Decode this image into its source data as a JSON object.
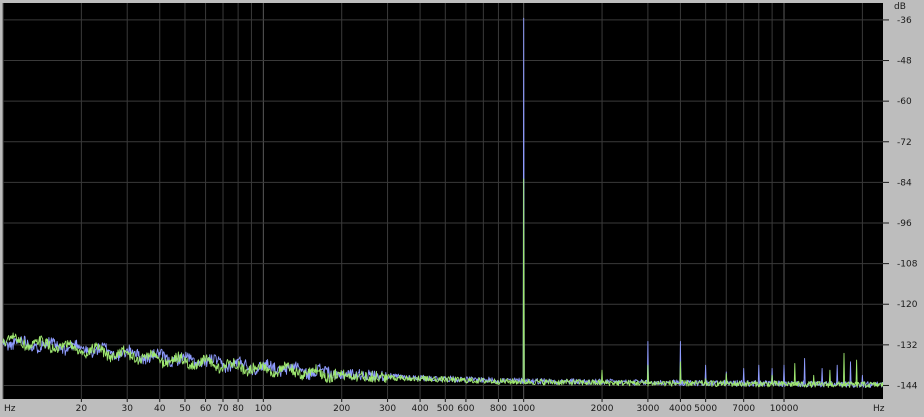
{
  "chart_data": {
    "type": "line",
    "title": "",
    "xlabel": "Hz",
    "ylabel": "dB",
    "x_scale": "log",
    "xlim": [
      10,
      24000
    ],
    "ylim": [
      -148,
      -31
    ],
    "grid": true,
    "x_tick_labels": [
      "20",
      "30",
      "40",
      "50",
      "60",
      "70",
      "80",
      "100",
      "200",
      "300",
      "400",
      "500",
      "600",
      "800",
      "1000",
      "2000",
      "3000",
      "4000",
      "5000",
      "7000",
      "10000"
    ],
    "x_tick_values": [
      20,
      30,
      40,
      50,
      60,
      70,
      80,
      100,
      200,
      300,
      400,
      500,
      600,
      800,
      1000,
      2000,
      3000,
      4000,
      5000,
      7000,
      10000
    ],
    "y_ticks": [
      -36,
      -48,
      -60,
      -72,
      -84,
      -96,
      -108,
      -120,
      -132,
      -144
    ],
    "y_tick_labels": [
      "-36",
      "-48",
      "-60",
      "-72",
      "-84",
      "-96",
      "-108",
      "-120",
      "-132",
      "-144"
    ],
    "x_unit_left": "Hz",
    "x_unit_right": "Hz",
    "y_unit": "dB",
    "colors": {
      "background": "#000000",
      "grid": "#3a3a3a",
      "frame": "#bdbdbd",
      "series_blue": "#8f9cff",
      "series_green": "#9fe870"
    },
    "series": [
      {
        "color": "#8f9cff",
        "floor": [
          [
            10,
            -131
          ],
          [
            20,
            -133
          ],
          [
            50,
            -136.5
          ],
          [
            100,
            -138.5
          ],
          [
            200,
            -140.5
          ],
          [
            400,
            -141.8
          ],
          [
            800,
            -142.5
          ],
          [
            2000,
            -143
          ],
          [
            10000,
            -143.5
          ],
          [
            20000,
            -143.8
          ]
        ],
        "peaks": [
          [
            1000,
            -35.5
          ],
          [
            3000,
            -131
          ],
          [
            4000,
            -131
          ],
          [
            5000,
            -138
          ],
          [
            6000,
            -140
          ],
          [
            7000,
            -139
          ],
          [
            8000,
            -138
          ],
          [
            9000,
            -139
          ],
          [
            10000,
            -138
          ],
          [
            12000,
            -136
          ],
          [
            14000,
            -139
          ],
          [
            16000,
            -138
          ],
          [
            18000,
            -137
          ],
          [
            20000,
            -141
          ]
        ]
      },
      {
        "color": "#9fe870",
        "floor": [
          [
            10,
            -130.5
          ],
          [
            20,
            -133.5
          ],
          [
            50,
            -137
          ],
          [
            100,
            -139
          ],
          [
            200,
            -141
          ],
          [
            400,
            -142
          ],
          [
            800,
            -142.8
          ],
          [
            2000,
            -143.2
          ],
          [
            10000,
            -143.6
          ],
          [
            20000,
            -143.8
          ]
        ],
        "peaks": [
          [
            1000,
            -83
          ],
          [
            2000,
            -139.5
          ],
          [
            3000,
            -138
          ],
          [
            4000,
            -137
          ],
          [
            5000,
            -142
          ],
          [
            6000,
            -140.5
          ],
          [
            9000,
            -141
          ],
          [
            11000,
            -137.5
          ],
          [
            13000,
            -141
          ],
          [
            15000,
            -139.5
          ],
          [
            17000,
            -134.5
          ],
          [
            19000,
            -136.5
          ]
        ]
      }
    ]
  }
}
